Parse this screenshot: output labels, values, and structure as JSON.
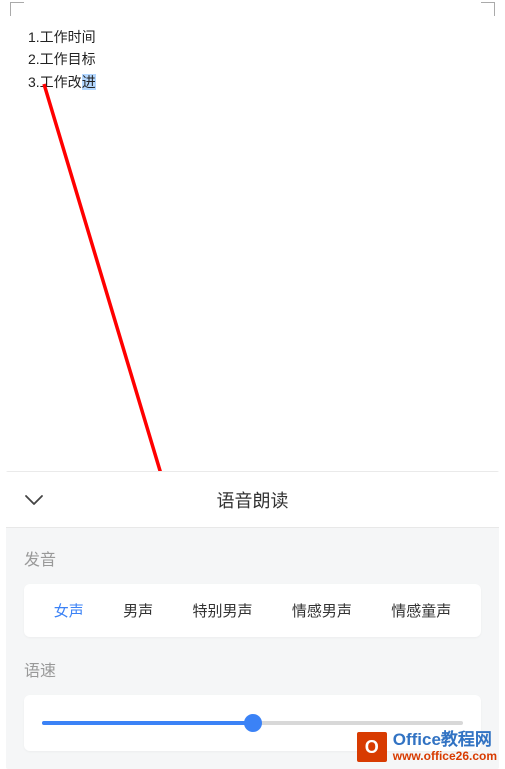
{
  "document": {
    "lines": [
      "1.工作时间",
      "2.工作目标",
      "3.工作改"
    ],
    "highlighted_char": "进"
  },
  "panel": {
    "title": "语音朗读",
    "voice_section_label": "发音",
    "voice_options": [
      "女声",
      "男声",
      "特别男声",
      "情感男声",
      "情感童声"
    ],
    "active_voice_index": 0,
    "speed_section_label": "语速",
    "speed_value": 50
  },
  "watermark": {
    "logo_letter": "O",
    "title": "Office教程网",
    "url": "www.office26.com"
  }
}
